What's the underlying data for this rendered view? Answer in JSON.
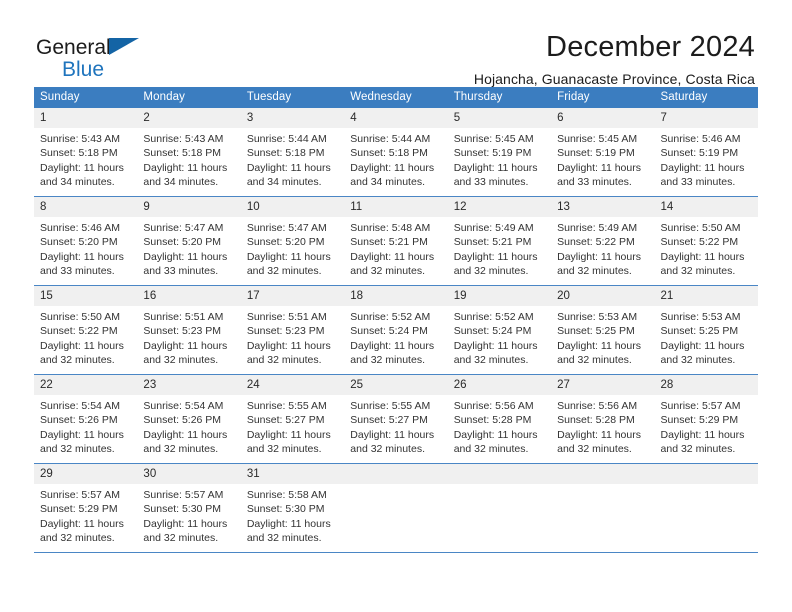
{
  "brand": {
    "line1": "General",
    "line2": "Blue",
    "triangle_color": "#1464a5"
  },
  "header": {
    "title": "December 2024",
    "subtitle": "Hojancha, Guanacaste Province, Costa Rica"
  },
  "theme": {
    "header_bg": "#3b7dc0",
    "day_strip_bg": "#f0f0f0",
    "row_border": "#4a86c5",
    "text": "#333333"
  },
  "weekdays": [
    "Sunday",
    "Monday",
    "Tuesday",
    "Wednesday",
    "Thursday",
    "Friday",
    "Saturday"
  ],
  "weeks": [
    [
      {
        "day": "1",
        "sunrise": "Sunrise: 5:43 AM",
        "sunset": "Sunset: 5:18 PM",
        "daylight1": "Daylight: 11 hours",
        "daylight2": "and 34 minutes."
      },
      {
        "day": "2",
        "sunrise": "Sunrise: 5:43 AM",
        "sunset": "Sunset: 5:18 PM",
        "daylight1": "Daylight: 11 hours",
        "daylight2": "and 34 minutes."
      },
      {
        "day": "3",
        "sunrise": "Sunrise: 5:44 AM",
        "sunset": "Sunset: 5:18 PM",
        "daylight1": "Daylight: 11 hours",
        "daylight2": "and 34 minutes."
      },
      {
        "day": "4",
        "sunrise": "Sunrise: 5:44 AM",
        "sunset": "Sunset: 5:18 PM",
        "daylight1": "Daylight: 11 hours",
        "daylight2": "and 34 minutes."
      },
      {
        "day": "5",
        "sunrise": "Sunrise: 5:45 AM",
        "sunset": "Sunset: 5:19 PM",
        "daylight1": "Daylight: 11 hours",
        "daylight2": "and 33 minutes."
      },
      {
        "day": "6",
        "sunrise": "Sunrise: 5:45 AM",
        "sunset": "Sunset: 5:19 PM",
        "daylight1": "Daylight: 11 hours",
        "daylight2": "and 33 minutes."
      },
      {
        "day": "7",
        "sunrise": "Sunrise: 5:46 AM",
        "sunset": "Sunset: 5:19 PM",
        "daylight1": "Daylight: 11 hours",
        "daylight2": "and 33 minutes."
      }
    ],
    [
      {
        "day": "8",
        "sunrise": "Sunrise: 5:46 AM",
        "sunset": "Sunset: 5:20 PM",
        "daylight1": "Daylight: 11 hours",
        "daylight2": "and 33 minutes."
      },
      {
        "day": "9",
        "sunrise": "Sunrise: 5:47 AM",
        "sunset": "Sunset: 5:20 PM",
        "daylight1": "Daylight: 11 hours",
        "daylight2": "and 33 minutes."
      },
      {
        "day": "10",
        "sunrise": "Sunrise: 5:47 AM",
        "sunset": "Sunset: 5:20 PM",
        "daylight1": "Daylight: 11 hours",
        "daylight2": "and 32 minutes."
      },
      {
        "day": "11",
        "sunrise": "Sunrise: 5:48 AM",
        "sunset": "Sunset: 5:21 PM",
        "daylight1": "Daylight: 11 hours",
        "daylight2": "and 32 minutes."
      },
      {
        "day": "12",
        "sunrise": "Sunrise: 5:49 AM",
        "sunset": "Sunset: 5:21 PM",
        "daylight1": "Daylight: 11 hours",
        "daylight2": "and 32 minutes."
      },
      {
        "day": "13",
        "sunrise": "Sunrise: 5:49 AM",
        "sunset": "Sunset: 5:22 PM",
        "daylight1": "Daylight: 11 hours",
        "daylight2": "and 32 minutes."
      },
      {
        "day": "14",
        "sunrise": "Sunrise: 5:50 AM",
        "sunset": "Sunset: 5:22 PM",
        "daylight1": "Daylight: 11 hours",
        "daylight2": "and 32 minutes."
      }
    ],
    [
      {
        "day": "15",
        "sunrise": "Sunrise: 5:50 AM",
        "sunset": "Sunset: 5:22 PM",
        "daylight1": "Daylight: 11 hours",
        "daylight2": "and 32 minutes."
      },
      {
        "day": "16",
        "sunrise": "Sunrise: 5:51 AM",
        "sunset": "Sunset: 5:23 PM",
        "daylight1": "Daylight: 11 hours",
        "daylight2": "and 32 minutes."
      },
      {
        "day": "17",
        "sunrise": "Sunrise: 5:51 AM",
        "sunset": "Sunset: 5:23 PM",
        "daylight1": "Daylight: 11 hours",
        "daylight2": "and 32 minutes."
      },
      {
        "day": "18",
        "sunrise": "Sunrise: 5:52 AM",
        "sunset": "Sunset: 5:24 PM",
        "daylight1": "Daylight: 11 hours",
        "daylight2": "and 32 minutes."
      },
      {
        "day": "19",
        "sunrise": "Sunrise: 5:52 AM",
        "sunset": "Sunset: 5:24 PM",
        "daylight1": "Daylight: 11 hours",
        "daylight2": "and 32 minutes."
      },
      {
        "day": "20",
        "sunrise": "Sunrise: 5:53 AM",
        "sunset": "Sunset: 5:25 PM",
        "daylight1": "Daylight: 11 hours",
        "daylight2": "and 32 minutes."
      },
      {
        "day": "21",
        "sunrise": "Sunrise: 5:53 AM",
        "sunset": "Sunset: 5:25 PM",
        "daylight1": "Daylight: 11 hours",
        "daylight2": "and 32 minutes."
      }
    ],
    [
      {
        "day": "22",
        "sunrise": "Sunrise: 5:54 AM",
        "sunset": "Sunset: 5:26 PM",
        "daylight1": "Daylight: 11 hours",
        "daylight2": "and 32 minutes."
      },
      {
        "day": "23",
        "sunrise": "Sunrise: 5:54 AM",
        "sunset": "Sunset: 5:26 PM",
        "daylight1": "Daylight: 11 hours",
        "daylight2": "and 32 minutes."
      },
      {
        "day": "24",
        "sunrise": "Sunrise: 5:55 AM",
        "sunset": "Sunset: 5:27 PM",
        "daylight1": "Daylight: 11 hours",
        "daylight2": "and 32 minutes."
      },
      {
        "day": "25",
        "sunrise": "Sunrise: 5:55 AM",
        "sunset": "Sunset: 5:27 PM",
        "daylight1": "Daylight: 11 hours",
        "daylight2": "and 32 minutes."
      },
      {
        "day": "26",
        "sunrise": "Sunrise: 5:56 AM",
        "sunset": "Sunset: 5:28 PM",
        "daylight1": "Daylight: 11 hours",
        "daylight2": "and 32 minutes."
      },
      {
        "day": "27",
        "sunrise": "Sunrise: 5:56 AM",
        "sunset": "Sunset: 5:28 PM",
        "daylight1": "Daylight: 11 hours",
        "daylight2": "and 32 minutes."
      },
      {
        "day": "28",
        "sunrise": "Sunrise: 5:57 AM",
        "sunset": "Sunset: 5:29 PM",
        "daylight1": "Daylight: 11 hours",
        "daylight2": "and 32 minutes."
      }
    ],
    [
      {
        "day": "29",
        "sunrise": "Sunrise: 5:57 AM",
        "sunset": "Sunset: 5:29 PM",
        "daylight1": "Daylight: 11 hours",
        "daylight2": "and 32 minutes."
      },
      {
        "day": "30",
        "sunrise": "Sunrise: 5:57 AM",
        "sunset": "Sunset: 5:30 PM",
        "daylight1": "Daylight: 11 hours",
        "daylight2": "and 32 minutes."
      },
      {
        "day": "31",
        "sunrise": "Sunrise: 5:58 AM",
        "sunset": "Sunset: 5:30 PM",
        "daylight1": "Daylight: 11 hours",
        "daylight2": "and 32 minutes."
      },
      {
        "day": "",
        "sunrise": "",
        "sunset": "",
        "daylight1": "",
        "daylight2": ""
      },
      {
        "day": "",
        "sunrise": "",
        "sunset": "",
        "daylight1": "",
        "daylight2": ""
      },
      {
        "day": "",
        "sunrise": "",
        "sunset": "",
        "daylight1": "",
        "daylight2": ""
      },
      {
        "day": "",
        "sunrise": "",
        "sunset": "",
        "daylight1": "",
        "daylight2": ""
      }
    ]
  ]
}
